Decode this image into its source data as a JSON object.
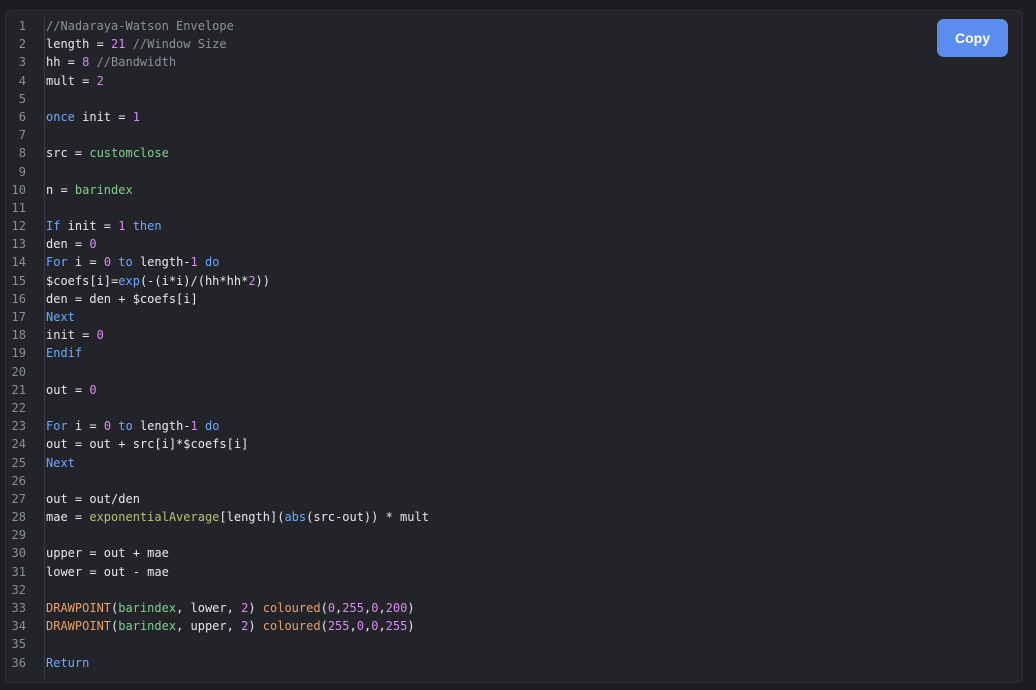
{
  "copy_button": {
    "label": "Copy"
  },
  "code": {
    "line_numbers": [
      "1",
      "2",
      "3",
      "4",
      "5",
      "6",
      "7",
      "8",
      "9",
      "10",
      "11",
      "12",
      "13",
      "14",
      "15",
      "16",
      "17",
      "18",
      "19",
      "20",
      "21",
      "22",
      "23",
      "24",
      "25",
      "26",
      "27",
      "28",
      "29",
      "30",
      "31",
      "32",
      "33",
      "34",
      "35",
      "36"
    ],
    "l1": {
      "comment": "//Nadaraya-Watson Envelope"
    },
    "l2": {
      "a": "length = ",
      "n": "21",
      "c": " //Window Size"
    },
    "l3": {
      "a": "hh = ",
      "n": "8",
      "c": " //Bandwidth"
    },
    "l4": {
      "a": "mult = ",
      "n": "2"
    },
    "l6": {
      "kw": "once",
      "a": " init = ",
      "n": "1"
    },
    "l8": {
      "a": "src = ",
      "f": "customclose"
    },
    "l10": {
      "a": "n = ",
      "f": "barindex"
    },
    "l12": {
      "kw": "If",
      "a": " init = ",
      "n": "1",
      "kw2": " then"
    },
    "l13": {
      "a": "den = ",
      "n": "0"
    },
    "l14": {
      "kw": "For",
      "a": " i = ",
      "n": "0",
      "kw2": " to",
      "b": " length-",
      "n2": "1",
      "kw3": " do"
    },
    "l15": {
      "a": "$coefs[i]=",
      "f": "exp",
      "b": "(-(i*i)/(hh*hh*",
      "n": "2",
      "c": "))"
    },
    "l16": {
      "a": "den = den + $coefs[i]"
    },
    "l17": {
      "kw": "Next"
    },
    "l18": {
      "a": "init = ",
      "n": "0"
    },
    "l19": {
      "kw": "Endif"
    },
    "l21": {
      "a": "out = ",
      "n": "0"
    },
    "l23": {
      "kw": "For",
      "a": " i = ",
      "n": "0",
      "kw2": " to",
      "b": " length-",
      "n2": "1",
      "kw3": " do"
    },
    "l24": {
      "a": "out = out + src[i]*$coefs[i]"
    },
    "l25": {
      "kw": "Next"
    },
    "l27": {
      "a": "out = out/den"
    },
    "l28": {
      "a": "mae = ",
      "f": "exponentialAverage",
      "b": "[length](",
      "f2": "abs",
      "c": "(src-out)) * mult"
    },
    "l30": {
      "a": "upper = out + mae"
    },
    "l31": {
      "a": "lower = out - mae"
    },
    "l33": {
      "f": "DRAWPOINT",
      "a": "(",
      "g": "barindex",
      "b": ", lower, ",
      "n": "2",
      "c": ") ",
      "f2": "coloured",
      "d": "(",
      "n2": "0",
      "e1": ",",
      "n3": "255",
      "e2": ",",
      "n4": "0",
      "e3": ",",
      "n5": "200",
      "e4": ")"
    },
    "l34": {
      "f": "DRAWPOINT",
      "a": "(",
      "g": "barindex",
      "b": ", upper, ",
      "n": "2",
      "c": ") ",
      "f2": "coloured",
      "d": "(",
      "n2": "255",
      "e1": ",",
      "n3": "0",
      "e2": ",",
      "n4": "0",
      "e3": ",",
      "n5": "255",
      "e4": ")"
    },
    "l36": {
      "kw": "Return"
    }
  },
  "colors": {
    "accent": "#5b8def",
    "keyword": "#6ea8ff",
    "number": "#d98cf0",
    "comment": "#8e9199",
    "builtin_green": "#7fd18a",
    "function_yellow": "#b5c46b",
    "drawcall_orange": "#e8a06a"
  }
}
